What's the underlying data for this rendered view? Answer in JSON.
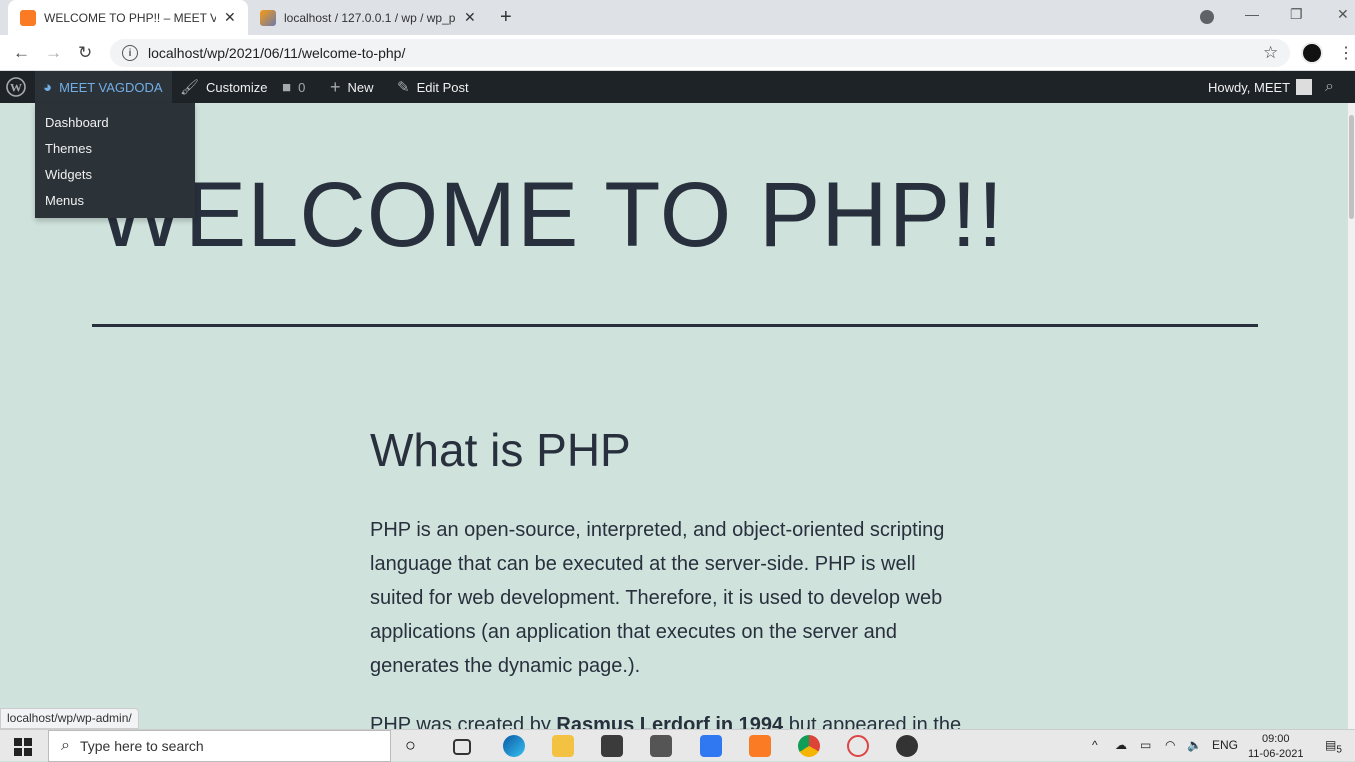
{
  "browser": {
    "tabs": [
      {
        "title": "WELCOME TO PHP!! – MEET VAG",
        "favicon": "xampp-icon",
        "active": true
      },
      {
        "title": "localhost / 127.0.0.1 / wp / wp_p",
        "favicon": "phpmyadmin-icon",
        "active": false
      }
    ],
    "url": "localhost/wp/2021/06/11/welcome-to-php/"
  },
  "adminbar": {
    "site_name": "MEET VAGDODA",
    "customize": "Customize",
    "comments_count": "0",
    "new": "New",
    "edit_post": "Edit Post",
    "howdy": "Howdy, MEET",
    "dropdown": [
      "Dashboard",
      "Themes",
      "Widgets",
      "Menus"
    ]
  },
  "post": {
    "title": "WELCOME TO PHP!!",
    "heading": "What is PHP",
    "paragraph": "PHP is an open-source, interpreted, and object-oriented scripting language that can be executed at the server-side. PHP is well suited for web development. Therefore, it is used to develop web applications (an application that executes on the server and generates the dynamic page.).",
    "para2_start": "PHP was created by ",
    "para2_bold": "Rasmus Lerdorf in 1994",
    "para2_end": " but appeared in the"
  },
  "status_url": "localhost/wp/wp-admin/",
  "taskbar": {
    "search_placeholder": "Type here to search",
    "language": "ENG",
    "time": "09:00",
    "date": "11-06-2021",
    "notifications": "5"
  },
  "colors": {
    "page_bg": "#cfe2dc",
    "text": "#28303d",
    "adminbar_bg": "#1d2327",
    "adminbar_link": "#72aee6"
  }
}
